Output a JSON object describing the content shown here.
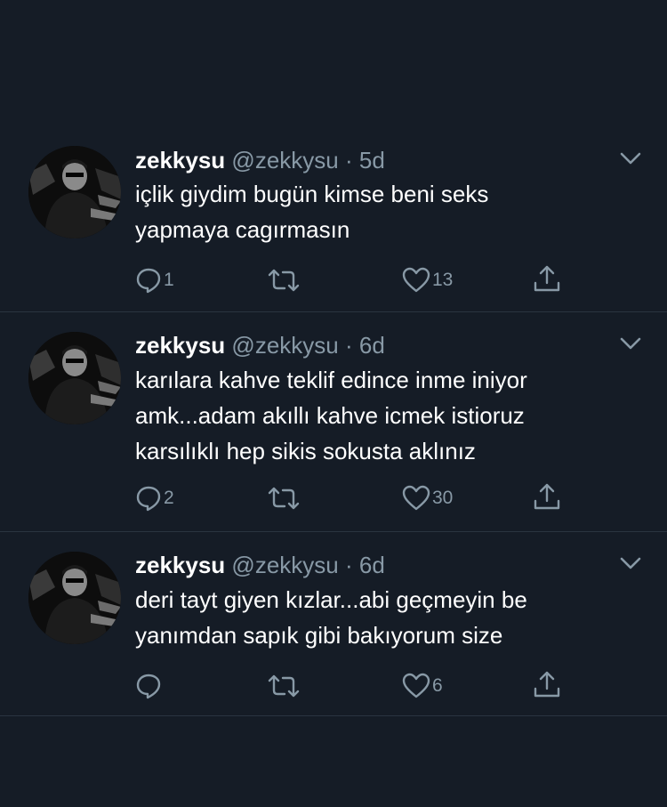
{
  "tweets": [
    {
      "display_name": "zekkysu",
      "handle": "@zekkysu",
      "separator": "·",
      "time": "5d",
      "lines": [
        "içlik giydim bugün kimse beni seks",
        "yapmaya cagırmasın"
      ],
      "replies": "1",
      "retweets": "",
      "likes": "13"
    },
    {
      "display_name": "zekkysu",
      "handle": "@zekkysu",
      "separator": "·",
      "time": "6d",
      "lines": [
        "karılara kahve teklif edince inme iniyor",
        "amk...adam akıllı kahve icmek istioruz",
        "karsılıklı hep sikis sokusta aklınız"
      ],
      "replies": "2",
      "retweets": "",
      "likes": "30"
    },
    {
      "display_name": "zekkysu",
      "handle": "@zekkysu",
      "separator": "·",
      "time": "6d",
      "lines": [
        "deri tayt giyen kızlar...abi geçmeyin be",
        "yanımdan sapık gibi bakıyorum size"
      ],
      "replies": "",
      "retweets": "",
      "likes": "6"
    }
  ],
  "icons": {
    "reply": "reply-icon",
    "retweet": "retweet-icon",
    "like": "heart-icon",
    "share": "share-icon",
    "menu": "chevron-down-icon"
  },
  "colors": {
    "background": "#151c26",
    "text": "#ffffff",
    "secondary": "#8899a6",
    "divider": "#2a3440"
  }
}
